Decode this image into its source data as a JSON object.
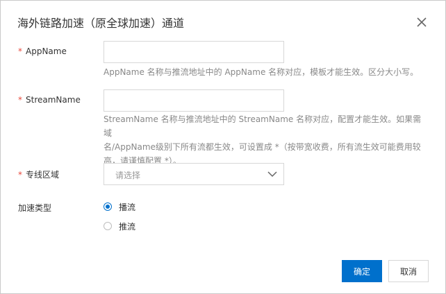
{
  "dialog": {
    "title": "海外链路加速（原全球加速）通道",
    "close_icon": "close-icon"
  },
  "form": {
    "app_name": {
      "required_mark": "*",
      "label": "AppName",
      "value": "",
      "help": "AppName 名称与推流地址中的 AppName 名称对应，模板才能生效。区分大小写。"
    },
    "stream_name": {
      "required_mark": "*",
      "label": "StreamName",
      "value": "",
      "help_lines": [
        "StreamName 名称与推流地址中的 StreamName 名称对应，配置才能生效。如果需域",
        "名/AppName级别下所有流都生效，可设置成 *（按带宽收费，所有流生效可能费用较",
        "高，请谨慎配置 *）。"
      ]
    },
    "region": {
      "required_mark": "*",
      "label": "专线区域",
      "placeholder": "请选择",
      "icon": "chevron-down-icon"
    },
    "accel_type": {
      "label": "加速类型",
      "options": [
        {
          "label": "播流",
          "checked": true
        },
        {
          "label": "推流",
          "checked": false
        }
      ]
    }
  },
  "footer": {
    "confirm_label": "确定",
    "cancel_label": "取消"
  },
  "colors": {
    "primary": "#0070cc",
    "required": "#e8493c",
    "help_text": "#888888",
    "border": "#d7d7d7"
  }
}
